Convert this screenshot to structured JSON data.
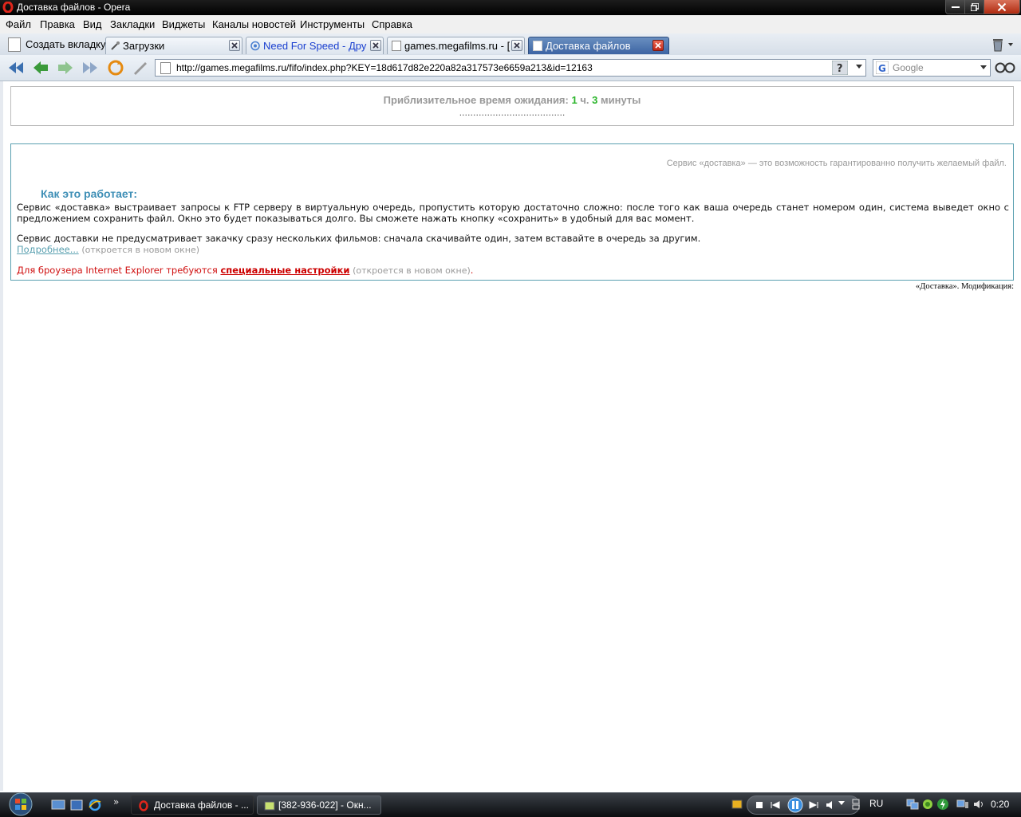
{
  "window": {
    "title": "Доставка файлов - Opera"
  },
  "menu": [
    "Файл",
    "Правка",
    "Вид",
    "Закладки",
    "Виджеты",
    "Каналы новостей",
    "Инструменты",
    "Справка"
  ],
  "tabs": {
    "new_tab_label": "Создать вкладку",
    "items": [
      {
        "label": "Загрузки"
      },
      {
        "label": "Need For Speed - Друг..."
      },
      {
        "label": "games.megafilms.ru - [..."
      },
      {
        "label": "Доставка файлов"
      }
    ]
  },
  "nav": {
    "url": "http://games.megafilms.ru/fifo/index.php?KEY=18d617d82e220a82a317573e6659a213&id=12163",
    "search_placeholder": "Google"
  },
  "page": {
    "wait": {
      "label": "Приблизительное время ожидания:",
      "hours": "1",
      "hours_unit": "ч.",
      "minutes": "3",
      "minutes_unit": "минуты",
      "dots": "......................................"
    },
    "tagline": "Сервис «доставка» — это возможность гарантированно получить желаемый файл.",
    "heading": "Как это работает:",
    "para1": "Сервис «доставка» выстраивает запросы к FTP серверу в виртуальную очередь, пропустить которую достаточно сложно: после того как ваша очередь станет номером один, система выведет окно с предложением сохранить файл. Окно это будет показываться долго. Вы сможете нажать кнопку «сохранить» в удобный для вас момент.",
    "para2": "Сервис доставки не предусматривает закачку сразу нескольких фильмов: сначала скачивайте один, затем вставайте в очередь за другим.",
    "more_link": "Подробнее...",
    "more_hint": "(откроется в новом окне)",
    "ie_prefix": "Для броузера Internet Explorer требуются",
    "ie_link": "специальные настройки",
    "ie_hint": "(откроется в новом окне)",
    "ie_suffix": ".",
    "footer": "«Доставка».  Модификация:"
  },
  "taskbar": {
    "tasks": [
      {
        "label": "Доставка файлов - ..."
      },
      {
        "label": "[382-936-022] - Окн..."
      }
    ],
    "quicklaunch_more": "»",
    "language": "RU",
    "clock": "0:20"
  },
  "colors": {
    "accent_teal": "#3f8fb6",
    "wait_green": "#2bb52b",
    "warning_red": "#d01010"
  }
}
